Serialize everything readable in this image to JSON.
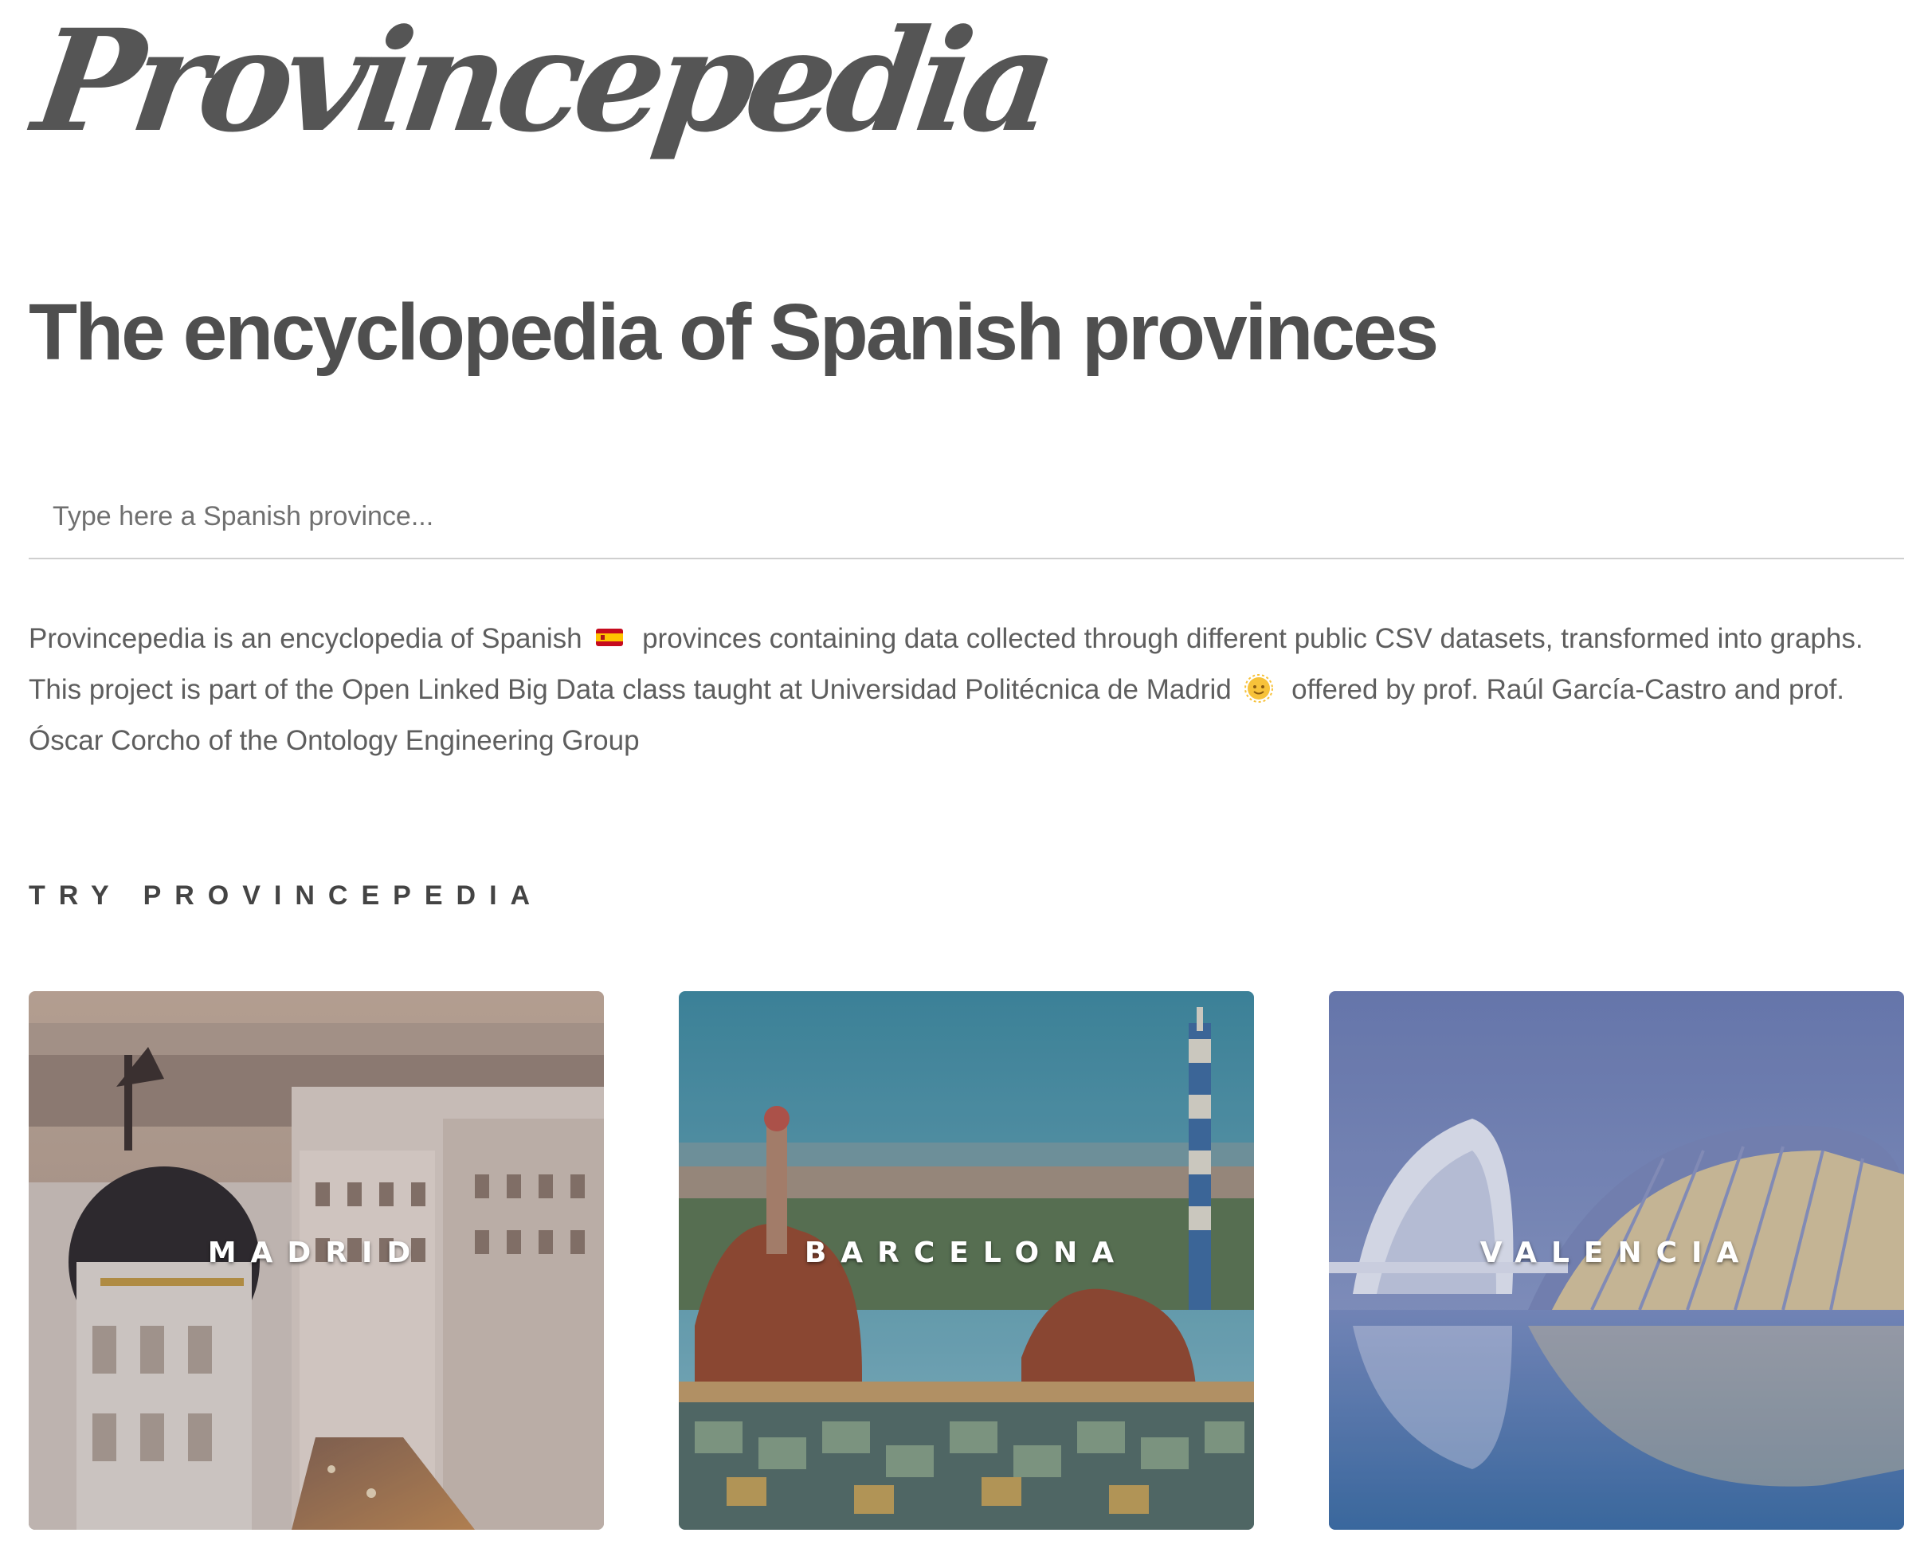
{
  "site": {
    "logo_text": "Provincepedia",
    "headline": "The encyclopedia of Spanish provinces"
  },
  "search": {
    "placeholder": "Type here a Spanish province..."
  },
  "intro": {
    "part1": "Provincepedia is an encyclopedia of Spanish",
    "part2": "provinces containing data collected through different public CSV datasets, transformed into graphs. This project is part of the Open Linked Big Data class taught at Universidad Politécnica de Madrid",
    "part3": "offered by prof. Raúl García-Castro and prof. Óscar Corcho of the Ontology Engineering Group",
    "flag_emoji": "spain-flag-icon",
    "sun_emoji": "sun-face-icon"
  },
  "section": {
    "title": "TRY PROVINCEPEDIA"
  },
  "cards": [
    {
      "label": "MADRID",
      "icon": "madrid-cityscape-image"
    },
    {
      "label": "BARCELONA",
      "icon": "barcelona-park-guell-image"
    },
    {
      "label": "VALENCIA",
      "icon": "valencia-arts-sciences-image"
    }
  ]
}
